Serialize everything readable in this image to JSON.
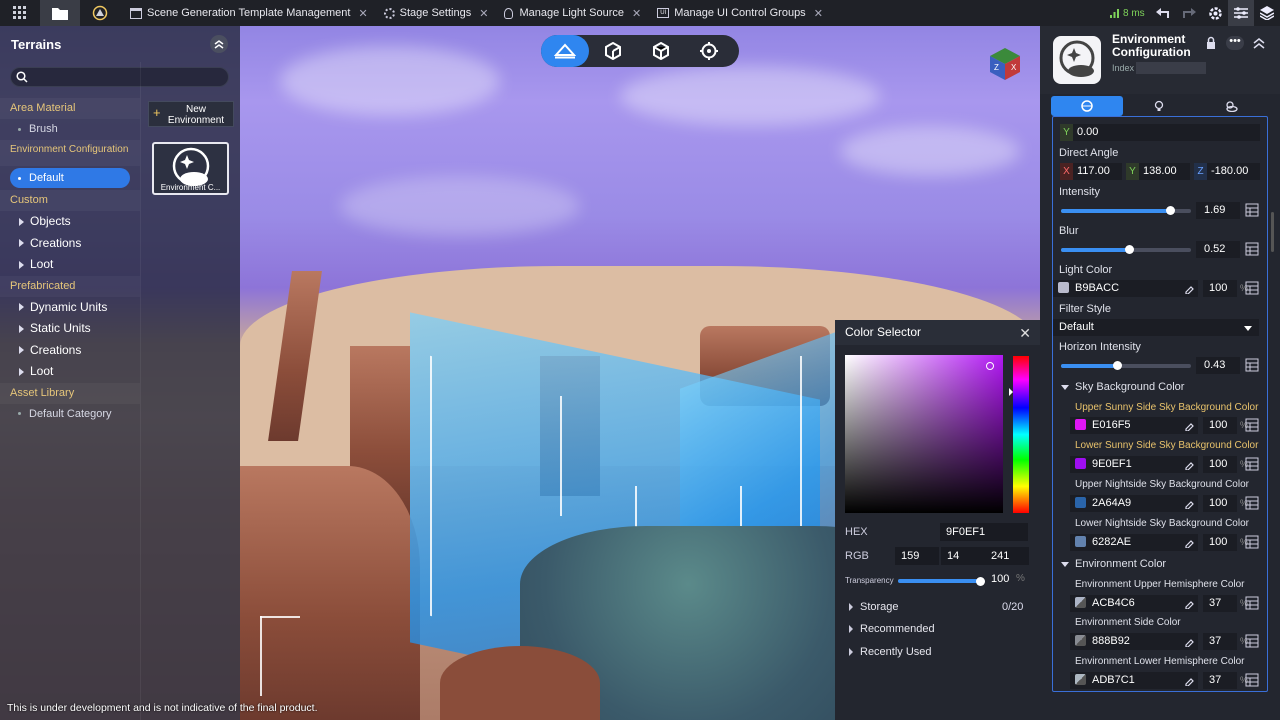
{
  "tabs": [
    {
      "label": "Scene Generation Template Management",
      "icon": "template-icon"
    },
    {
      "label": "Stage Settings",
      "icon": "gear-icon"
    },
    {
      "label": "Manage Light Source",
      "icon": "lightbulb-icon"
    },
    {
      "label": "Manage UI Control Groups",
      "icon": "ui-icon"
    }
  ],
  "perf": "8 ms",
  "left_panel": {
    "title": "Terrains",
    "search_placeholder": "",
    "sections": {
      "area_material": "Area Material",
      "brush": "Brush",
      "environment_configuration": "Environment Configuration",
      "default": "Default",
      "custom": "Custom",
      "objects": "Objects",
      "creations": "Creations",
      "loot": "Loot",
      "prefabricated": "Prefabricated",
      "dynamic_units": "Dynamic Units",
      "static_units": "Static Units",
      "creations2": "Creations",
      "loot2": "Loot",
      "asset_library": "Asset Library",
      "default_category": "Default Category"
    },
    "new_environment": "New Environment",
    "card_label": "Environment C..."
  },
  "color_selector": {
    "title": "Color Selector",
    "hex_label": "HEX",
    "hex": "9F0EF1",
    "rgb_label": "RGB",
    "r": "159",
    "g": "14",
    "b": "241",
    "transparency_label": "Transparency",
    "transparency": "100",
    "percent": "%",
    "transparency_fraction": 1.0,
    "storage": "Storage",
    "storage_count": "0/20",
    "recommended": "Recommended",
    "recently_used": "Recently Used"
  },
  "right_panel": {
    "title": "Environment Configuration",
    "index_label": "Index",
    "y_label": "Y",
    "y_value": "0.00",
    "direct_angle": "Direct Angle",
    "dx": "117.00",
    "dy": "138.00",
    "dz": "-180.00",
    "x_axis": "X",
    "y_axis": "Y",
    "z_axis": "Z",
    "intensity": "Intensity",
    "intensity_value": "1.69",
    "intensity_fraction": 0.84,
    "blur": "Blur",
    "blur_value": "0.52",
    "blur_fraction": 0.52,
    "light_color": "Light Color",
    "light_color_hex": "B9BACC",
    "light_color_pct": "100",
    "filter_style": "Filter Style",
    "filter_value": "Default",
    "horizon_intensity": "Horizon Intensity",
    "horizon_value": "0.43",
    "horizon_fraction": 0.43,
    "sky_bg": "Sky Background Color",
    "upper_sunny": "Upper Sunny Side Sky Background Color",
    "upper_sunny_hex": "E016F5",
    "upper_sunny_pct": "100",
    "lower_sunny": "Lower Sunny Side Sky Background Color",
    "lower_sunny_hex": "9E0EF1",
    "lower_sunny_pct": "100",
    "upper_night": "Upper Nightside Sky Background Color",
    "upper_night_hex": "2A64A9",
    "upper_night_pct": "100",
    "lower_night": "Lower Nightside Sky Background Color",
    "lower_night_hex": "6282AE",
    "lower_night_pct": "100",
    "env_color": "Environment Color",
    "env_upper": "Environment Upper Hemisphere Color",
    "env_upper_hex": "ACB4C6",
    "env_upper_pct": "37",
    "env_side": "Environment Side Color",
    "env_side_hex": "888B92",
    "env_side_pct": "37",
    "env_lower": "Environment Lower Hemisphere Color",
    "env_lower_hex": "ADB7C1",
    "env_lower_pct": "37",
    "pct_sign": "%"
  },
  "footnote": "This is under development and is not indicative of the final product.",
  "colors": {
    "accent": "#2f86f0",
    "light": "#b9bacc",
    "upper_sunny": "#e016f5",
    "lower_sunny": "#9e0ef1",
    "upper_night": "#2a64a9",
    "lower_night": "#6282ae",
    "env_upper": "#acb4c6",
    "env_side": "#888b92",
    "env_lower": "#adb7c1"
  }
}
